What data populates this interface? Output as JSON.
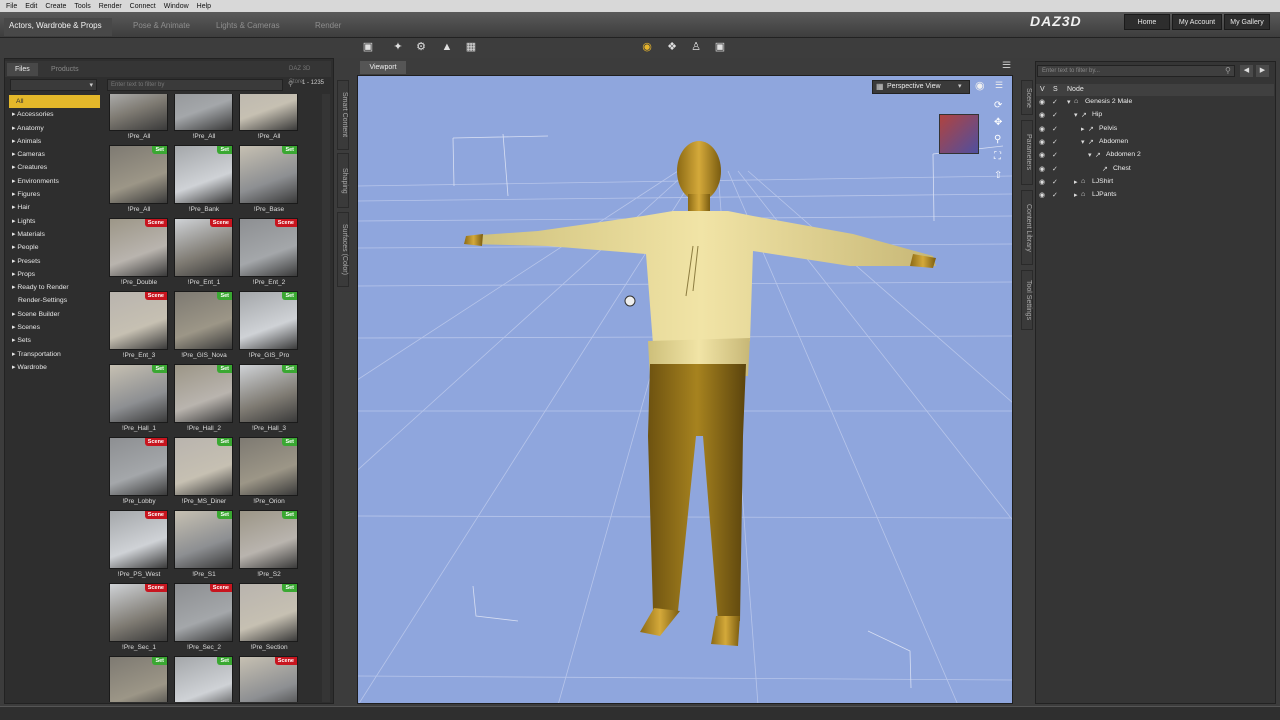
{
  "menu": [
    "File",
    "Edit",
    "Create",
    "Tools",
    "Render",
    "Connect",
    "Window",
    "Help"
  ],
  "tabs": {
    "active": "Actors, Wardrobe & Props",
    "others": [
      "Pose & Animate",
      "Lights & Cameras",
      "Render"
    ]
  },
  "brand": {
    "logo": "DAZ3D",
    "buttons": [
      "Home",
      "My Account",
      "My Gallery"
    ]
  },
  "left": {
    "tabs": [
      "Files",
      "Products"
    ],
    "vendor": "DAZ 3D Store",
    "filter_placeholder": "Enter text to filter by",
    "count": "1 - 1235",
    "categories": [
      "All",
      "Accessories",
      "Anatomy",
      "Animals",
      "Cameras",
      "Creatures",
      "Environments",
      "Figures",
      "Hair",
      "Lights",
      "Materials",
      "People",
      "Presets",
      "Props",
      "Ready to Render",
      "Render-Settings",
      "Scene Builder",
      "Scenes",
      "Sets",
      "Transportation",
      "Wardrobe"
    ],
    "items": [
      {
        "label": "!Pre_All",
        "badge": ""
      },
      {
        "label": "!Pre_All",
        "badge": ""
      },
      {
        "label": "!Pre_All",
        "badge": ""
      },
      {
        "label": "!Pre_All",
        "badge": "Set"
      },
      {
        "label": "!Pre_Bank",
        "badge": "Set"
      },
      {
        "label": "!Pre_Base",
        "badge": "Set"
      },
      {
        "label": "!Pre_Double",
        "badge": "Scene"
      },
      {
        "label": "!Pre_Ent_1",
        "badge": "Scene"
      },
      {
        "label": "!Pre_Ent_2",
        "badge": "Scene"
      },
      {
        "label": "!Pre_Ent_3",
        "badge": "Scene"
      },
      {
        "label": "!Pre_GIS_Nova",
        "badge": "Set"
      },
      {
        "label": "!Pre_GIS_Pro",
        "badge": "Set"
      },
      {
        "label": "!Pre_Hall_1",
        "badge": "Set"
      },
      {
        "label": "!Pre_Hall_2",
        "badge": "Set"
      },
      {
        "label": "!Pre_Hall_3",
        "badge": "Set"
      },
      {
        "label": "!Pre_Lobby",
        "badge": "Scene"
      },
      {
        "label": "!Pre_MS_Diner",
        "badge": "Set"
      },
      {
        "label": "!Pre_Orion",
        "badge": "Set"
      },
      {
        "label": "!Pre_PS_West",
        "badge": "Scene"
      },
      {
        "label": "!Pre_S1",
        "badge": "Set"
      },
      {
        "label": "!Pre_S2",
        "badge": "Set"
      },
      {
        "label": "!Pre_Sec_1",
        "badge": "Scene"
      },
      {
        "label": "!Pre_Sec_2",
        "badge": "Scene"
      },
      {
        "label": "!Pre_Section",
        "badge": "Set"
      },
      {
        "label": "",
        "badge": "Set"
      },
      {
        "label": "",
        "badge": "Set"
      },
      {
        "label": "",
        "badge": "Scene"
      }
    ],
    "side_tabs": [
      "Smart Content",
      "Shaping",
      "Surfaces (Color)"
    ]
  },
  "viewport": {
    "tab": "Viewport",
    "view": "Perspective View"
  },
  "right": {
    "filter_placeholder": "Enter text to filter by...",
    "head": {
      "v": "V",
      "s": "S",
      "node": "Node"
    },
    "nodes": [
      "Genesis 2 Male",
      "Hip",
      "Pelvis",
      "Abdomen",
      "Abdomen 2",
      "Chest",
      "LJShirt",
      "LJPants"
    ],
    "side_tabs": [
      "Scene",
      "Parameters",
      "Content Library",
      "Tool Settings"
    ]
  },
  "colors": {
    "accent": "#e4b82a",
    "set": "#3aa832",
    "scene": "#c8151f",
    "viewport": "#8fa6dd"
  }
}
